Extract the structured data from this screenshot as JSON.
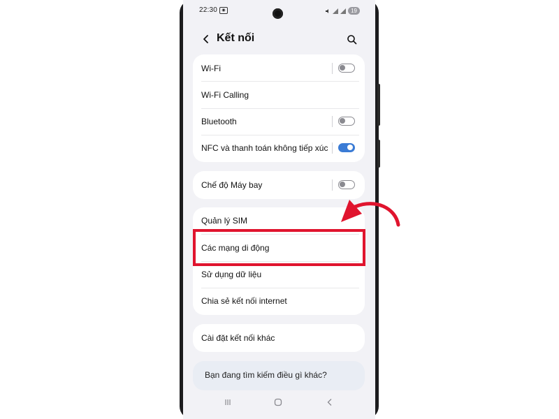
{
  "status_bar": {
    "time": "22:30",
    "battery": "19"
  },
  "header": {
    "title": "Kết nối"
  },
  "group1": [
    {
      "label": "Wi-Fi",
      "toggle": "off"
    },
    {
      "label": "Wi-Fi Calling"
    },
    {
      "label": "Bluetooth",
      "toggle": "off"
    },
    {
      "label": "NFC và thanh toán không tiếp xúc",
      "toggle": "on"
    }
  ],
  "group2": [
    {
      "label": "Chế độ Máy bay",
      "toggle": "off"
    }
  ],
  "group3": [
    {
      "label": "Quản lý SIM"
    },
    {
      "label": "Các mạng di động"
    },
    {
      "label": "Sử dụng dữ liệu"
    },
    {
      "label": "Chia sẻ kết nối internet"
    }
  ],
  "group4": [
    {
      "label": "Cài đặt kết nối khác"
    }
  ],
  "suggestion": {
    "text": "Bạn đang tìm kiếm điều gì khác?"
  },
  "colors": {
    "highlight": "#e0142e",
    "toggle_on": "#3a7bd5",
    "background": "#f2f2f6"
  },
  "icons": [
    "back-arrow-icon",
    "search-icon",
    "recents-icon",
    "home-icon",
    "nav-back-icon"
  ]
}
